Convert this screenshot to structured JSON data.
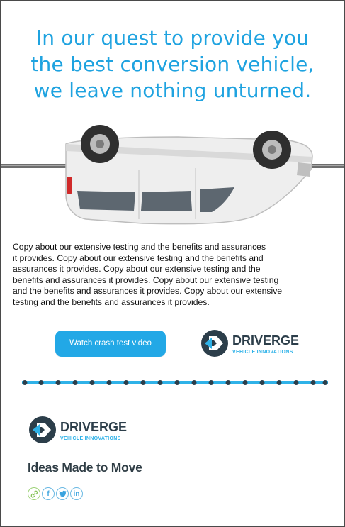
{
  "headline": {
    "lines": [
      "In our quest to provide you",
      "the best conversion vehicle,",
      "we leave nothing unturned."
    ]
  },
  "body": {
    "lines": [
      "Copy about our extensive testing and the benefits and assurances",
      "it provides. Copy about our extensive testing and the benefits and",
      "assurances it provides.  Copy about our extensive testing and the",
      "benefits and assurances it provides.  Copy about our extensive testing",
      "and the benefits and assurances it provides.  Copy about our extensive",
      "testing and the benefits and assurances it provides."
    ]
  },
  "cta": {
    "label": "Watch crash test video"
  },
  "brand": {
    "name": "DRIVERGE",
    "subtitle": "VEHICLE INNOVATIONS"
  },
  "footer": {
    "tagline": "Ideas Made to Move",
    "social": [
      {
        "icon": "link-icon",
        "glyph": "№"
      },
      {
        "icon": "facebook-icon",
        "glyph": "f"
      },
      {
        "icon": "twitter-icon",
        "glyph": "t"
      },
      {
        "icon": "linkedin-icon",
        "glyph": "in"
      }
    ]
  },
  "colors": {
    "accent": "#1fa3e0",
    "button": "#22a8e6",
    "dark": "#2f3d45",
    "brand_light": "#2fb2e8"
  }
}
